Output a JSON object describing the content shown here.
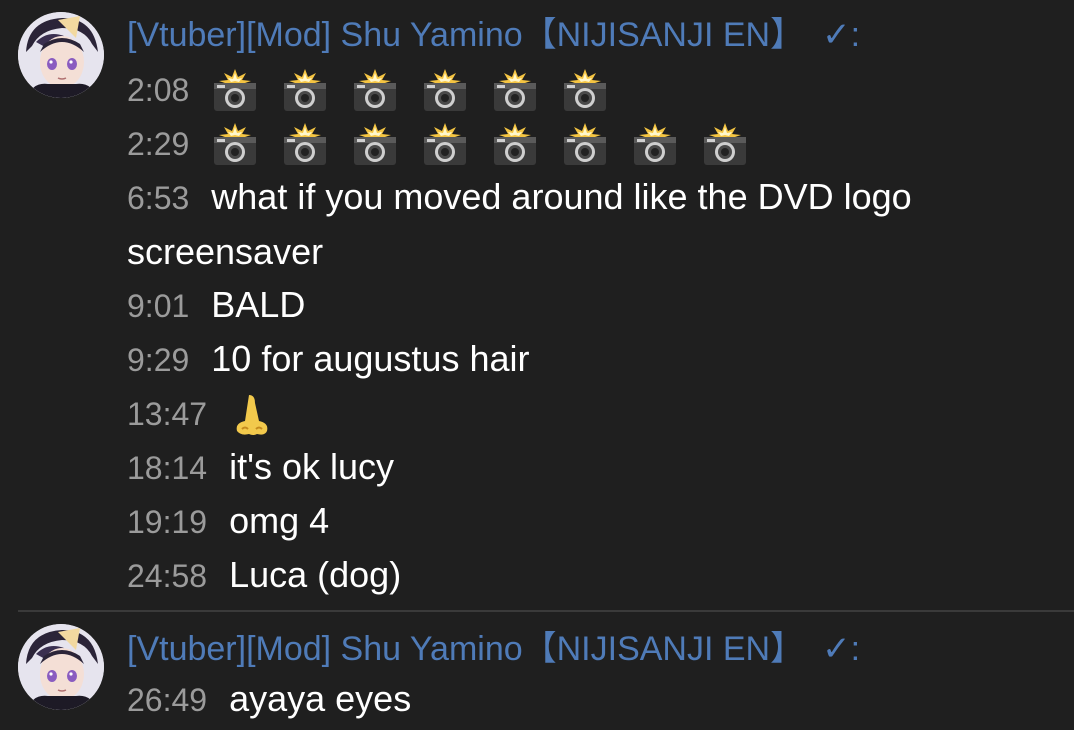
{
  "groups": [
    {
      "author": "[Vtuber][Mod] Shu Yamino【NIJISANJI EN】",
      "verified_mark": "✓:",
      "messages": [
        {
          "time": "2:08",
          "text": "",
          "emoji": "camera-with-flash",
          "emoji_count": 6
        },
        {
          "time": "2:29",
          "text": "",
          "emoji": "camera-with-flash",
          "emoji_count": 8
        },
        {
          "time": "6:53",
          "text": "what if you moved around like the DVD logo screensaver"
        },
        {
          "time": "9:01",
          "text": "BALD"
        },
        {
          "time": "9:29",
          "text": "10 for augustus hair"
        },
        {
          "time": "13:47",
          "text": "",
          "emoji": "nose"
        },
        {
          "time": "18:14",
          "text": "it's ok lucy"
        },
        {
          "time": "19:19",
          "text": "omg 4"
        },
        {
          "time": "24:58",
          "text": "Luca (dog)"
        }
      ]
    },
    {
      "author": "[Vtuber][Mod] Shu Yamino【NIJISANJI EN】",
      "verified_mark": "✓:",
      "messages": [
        {
          "time": "26:49",
          "text": "ayaya eyes"
        }
      ]
    }
  ],
  "colors": {
    "background": "#1f1f1f",
    "author": "#4f7bb8",
    "timestamp": "#9b9b9b",
    "text": "#ffffff",
    "divider": "#3a3a3a"
  }
}
